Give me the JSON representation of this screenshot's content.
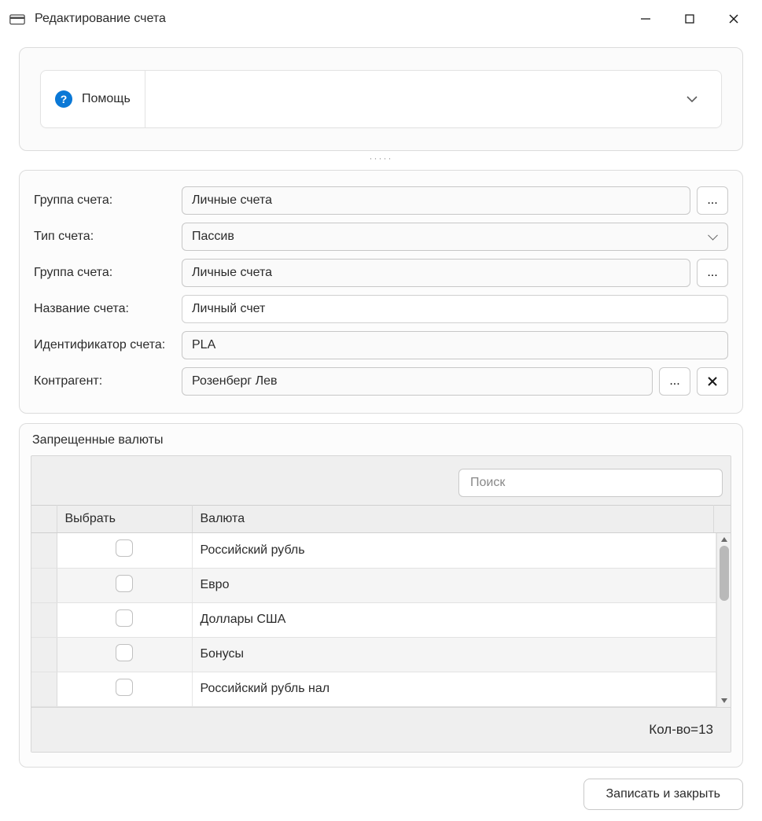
{
  "window": {
    "title": "Редактирование счета"
  },
  "help": {
    "label": "Помощь"
  },
  "drag_handle": "·····",
  "form": {
    "group1": {
      "label": "Группа счета:",
      "value": "Личные счета"
    },
    "type": {
      "label": "Тип счета:",
      "value": "Пассив"
    },
    "group2": {
      "label": "Группа счета:",
      "value": "Личные счета"
    },
    "name": {
      "label": "Название счета:",
      "value": "Личный счет"
    },
    "ident": {
      "label": "Идентификатор счета:",
      "value": "PLA"
    },
    "counterparty": {
      "label": "Контрагент:",
      "value": "Розенберг Лев"
    },
    "ellipsis": "...",
    "clear": "✕"
  },
  "currencies": {
    "legend": "Запрещенные валюты",
    "search_placeholder": "Поиск",
    "columns": {
      "select": "Выбрать",
      "currency": "Валюта"
    },
    "rows": [
      {
        "name": "Российский рубль"
      },
      {
        "name": "Евро"
      },
      {
        "name": "Доллары США"
      },
      {
        "name": "Бонусы"
      },
      {
        "name": "Российский рубль нал"
      }
    ],
    "footer": "Кол-во=13"
  },
  "actions": {
    "save_close": "Записать и закрыть"
  }
}
